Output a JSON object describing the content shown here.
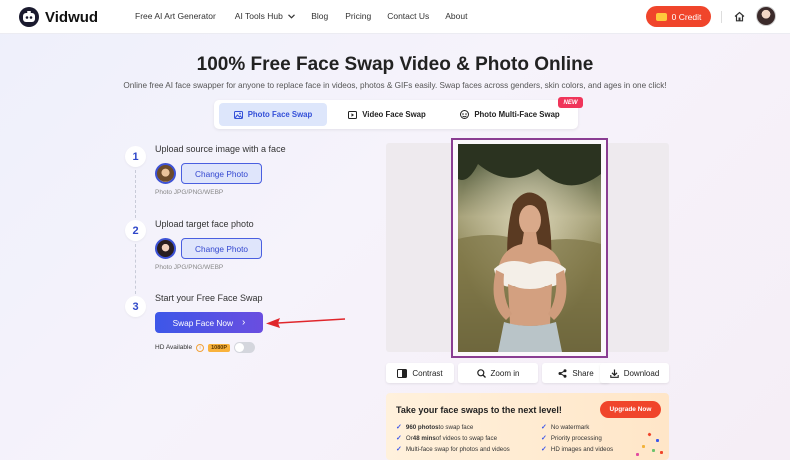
{
  "header": {
    "brand": "Vidwud",
    "nav": [
      {
        "label": "Free AI Art Generator"
      },
      {
        "label": "AI Tools Hub"
      },
      {
        "label": "Blog"
      },
      {
        "label": "Pricing"
      },
      {
        "label": "Contact Us"
      },
      {
        "label": "About"
      }
    ],
    "credit_label": "0 Credit"
  },
  "hero": {
    "title": "100% Free Face Swap Video & Photo Online",
    "subtitle": "Online free AI face swapper for anyone to replace face in videos, photos & GIFs easily. Swap faces across genders, skin colors, and ages in one click!"
  },
  "tabs": [
    {
      "label": "Photo Face Swap",
      "active": true
    },
    {
      "label": "Video Face Swap",
      "active": false
    },
    {
      "label": "Photo Multi-Face Swap",
      "active": false
    }
  ],
  "new_badge": "NEW",
  "steps": [
    {
      "number": "1",
      "title": "Upload source image with a face",
      "button": "Change Photo",
      "formats": "Photo JPG/PNG/WEBP"
    },
    {
      "number": "2",
      "title": "Upload target face photo",
      "button": "Change Photo",
      "formats": "Photo JPG/PNG/WEBP"
    },
    {
      "number": "3",
      "title": "Start your Free Face Swap",
      "button": "Swap Face Now"
    }
  ],
  "hd": {
    "label": "HD Available",
    "badge": "1080P",
    "enabled": false
  },
  "actions": [
    {
      "label": "Contrast",
      "icon": "contrast-icon"
    },
    {
      "label": "Zoom in",
      "icon": "zoom-icon"
    },
    {
      "label": "Share",
      "icon": "share-icon"
    },
    {
      "label": "Download",
      "icon": "download-icon"
    }
  ],
  "promo": {
    "title": "Take your face swaps to the next level!",
    "upgrade_label": "Upgrade Now",
    "features_left": [
      {
        "bold": "960 photos",
        "rest": " to swap face"
      },
      {
        "pre": "Or ",
        "bold": "48 mins",
        "rest": " of videos to swap face"
      },
      {
        "pre": "",
        "bold": "",
        "rest": "Multi-face swap for photos and videos"
      }
    ],
    "features_right": [
      "No watermark",
      "Priority processing",
      "HD images and videos"
    ]
  },
  "colors": {
    "accent": "#3d57e8",
    "credit": "#f0452b",
    "frame": "#8a3d92",
    "arrow": "#e0262b"
  }
}
